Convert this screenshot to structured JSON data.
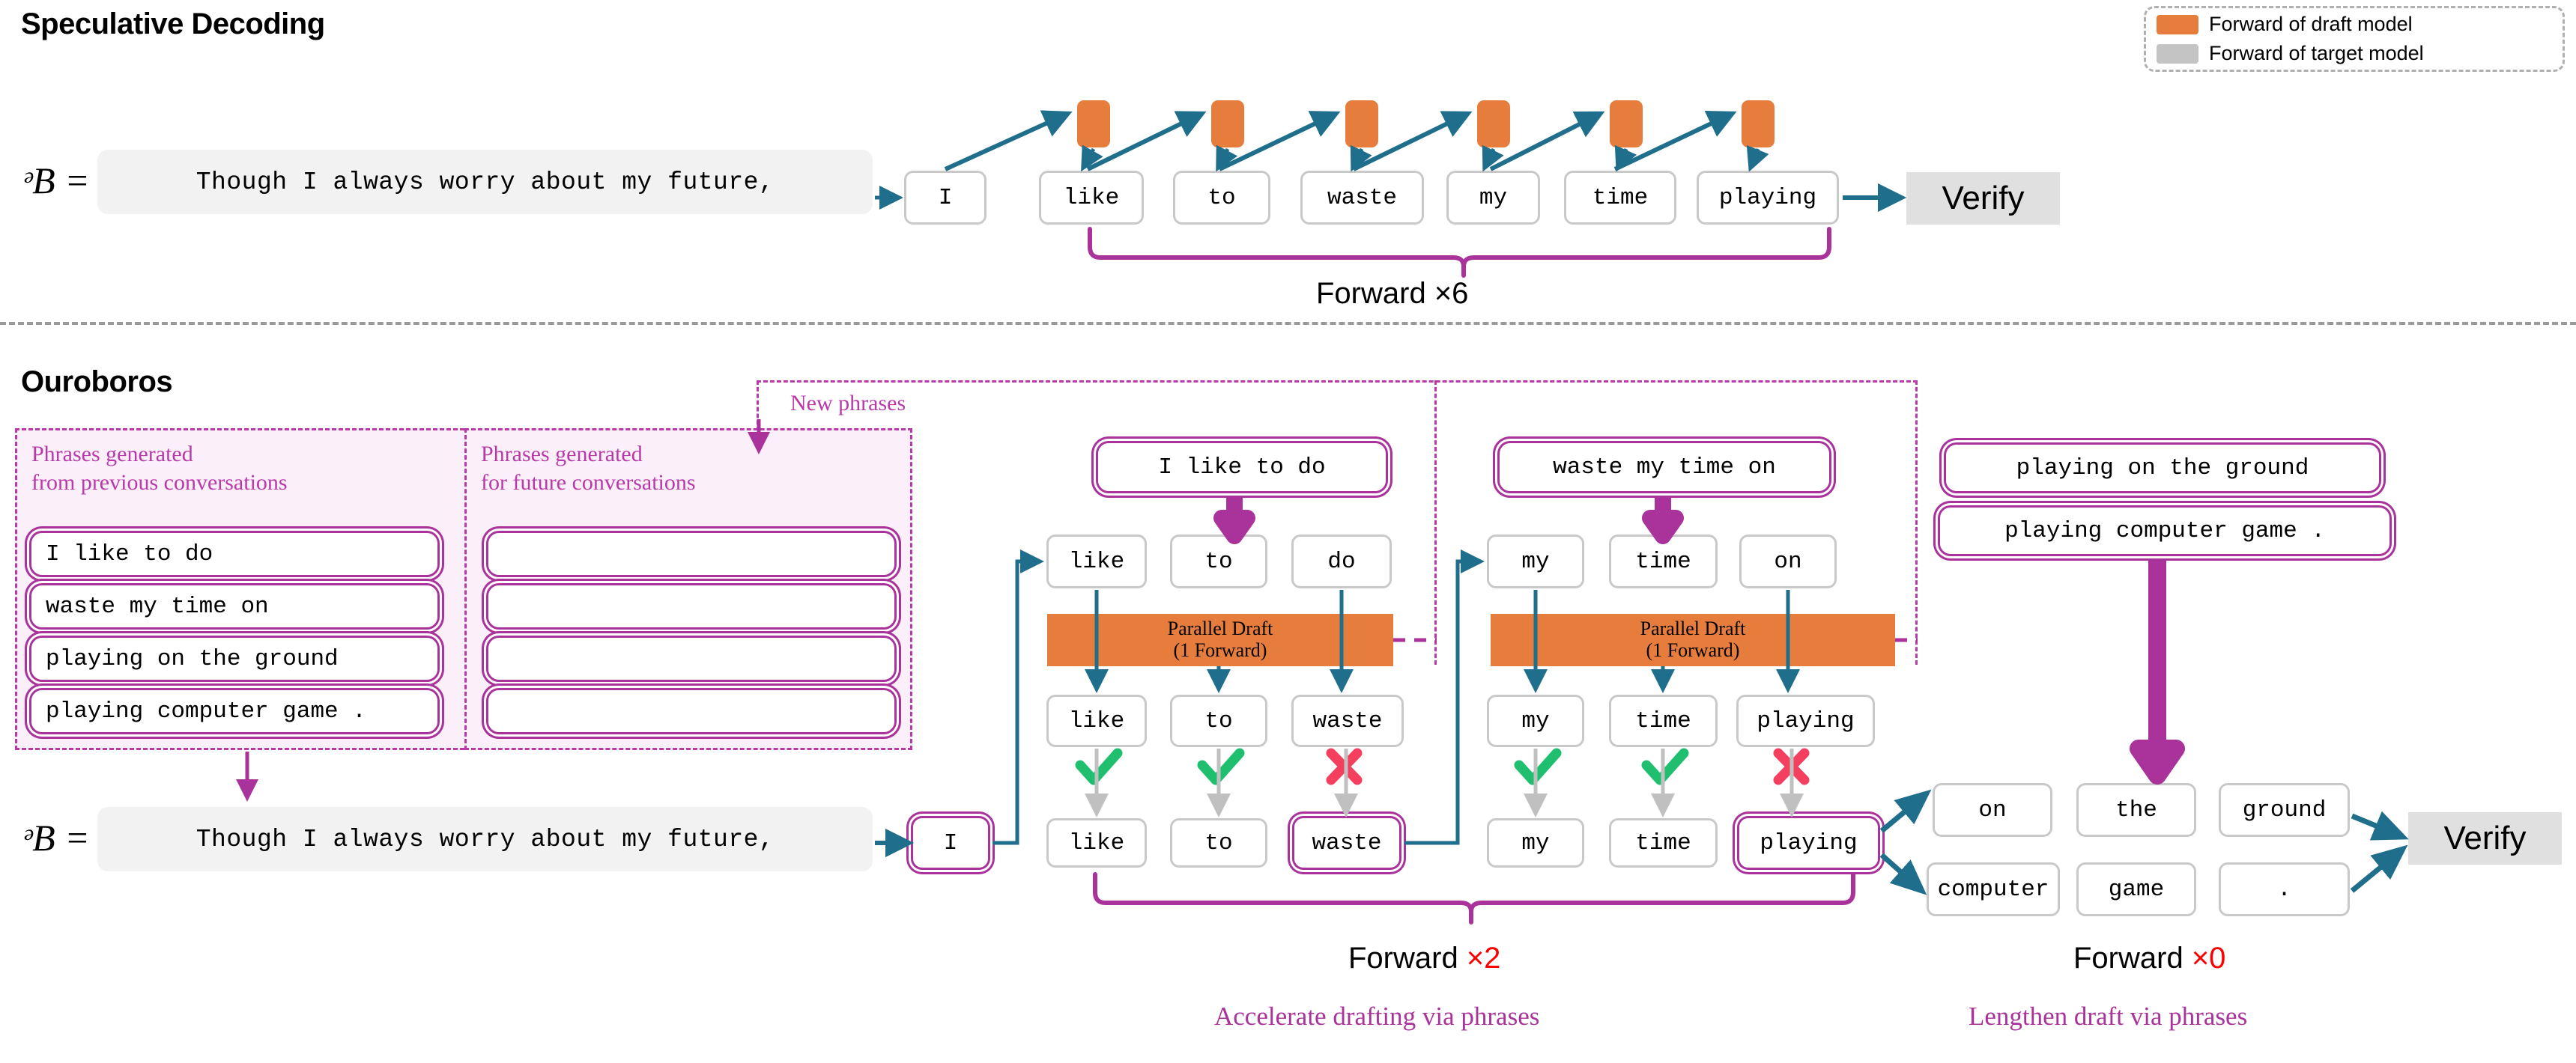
{
  "legend": {
    "items": [
      {
        "label": "Forward of draft  model",
        "color": "#e77d3c",
        "icon": "orange-swatch"
      },
      {
        "label": "Forward of target model",
        "color": "#c4c4c4",
        "icon": "grey-swatch"
      }
    ]
  },
  "speculative": {
    "title": "Speculative Decoding",
    "p_label": "ᵊB =",
    "prompt": "Though I always worry about my future,",
    "tokens": [
      "I",
      "like",
      "to",
      "waste",
      "my",
      "time",
      "playing"
    ],
    "draft_squares": 6,
    "verify_label": "Verify",
    "brace_caption": "Forward ×6"
  },
  "ouroboros": {
    "title": "Ouroboros",
    "p_label": "ᵊB =",
    "prompt": "Though I always worry about my future,",
    "new_phrases_label": "New phrases",
    "phrase_tables": [
      {
        "header_line1": "Phrases generated",
        "header_line2": "from previous conversations",
        "rows": [
          "I like to do",
          "waste my time on",
          "playing on the ground",
          "playing computer game ."
        ]
      },
      {
        "header_line1": "Phrases generated",
        "header_line2": "for future conversations",
        "rows": [
          "",
          "",
          "",
          ""
        ]
      }
    ],
    "start_token": "I",
    "blocks": [
      {
        "phrase": "I like to do",
        "input_tokens": [
          "like",
          "to",
          "do"
        ],
        "bar_line1": "Parallel Draft",
        "bar_line2": "(1 Forward)",
        "output_tokens": [
          "like",
          "to",
          "waste"
        ],
        "marks": [
          "check",
          "check",
          "cross"
        ],
        "final_tokens": [
          "like",
          "to",
          "waste"
        ],
        "final_highlight": [
          false,
          false,
          true
        ]
      },
      {
        "phrase": "waste my time on",
        "input_tokens": [
          "my",
          "time",
          "on"
        ],
        "bar_line1": "Parallel Draft",
        "bar_line2": "(1 Forward)",
        "output_tokens": [
          "my",
          "time",
          "playing"
        ],
        "marks": [
          "check",
          "check",
          "cross"
        ],
        "final_tokens": [
          "my",
          "time",
          "playing"
        ],
        "final_highlight": [
          false,
          false,
          true
        ]
      }
    ],
    "right_phrases": [
      "playing on the ground",
      "playing computer game ."
    ],
    "candidate_grid": [
      [
        "on",
        "the",
        "ground"
      ],
      [
        "computer",
        "game",
        "."
      ]
    ],
    "verify_label": "Verify",
    "captions": [
      {
        "prefix": "Forward ",
        "count": "×2",
        "sub": "Accelerate drafting via phrases"
      },
      {
        "prefix": "Forward ",
        "count": "×0",
        "sub": "Lengthen draft via phrases"
      }
    ]
  },
  "colors": {
    "orange": "#e77d3c",
    "teal": "#1f6e8c",
    "purple": "#a9339a",
    "pink_bg": "#fbeffa",
    "green": "#1fbf6f",
    "red": "#f43f5e",
    "grey": "#c9c9c9"
  }
}
